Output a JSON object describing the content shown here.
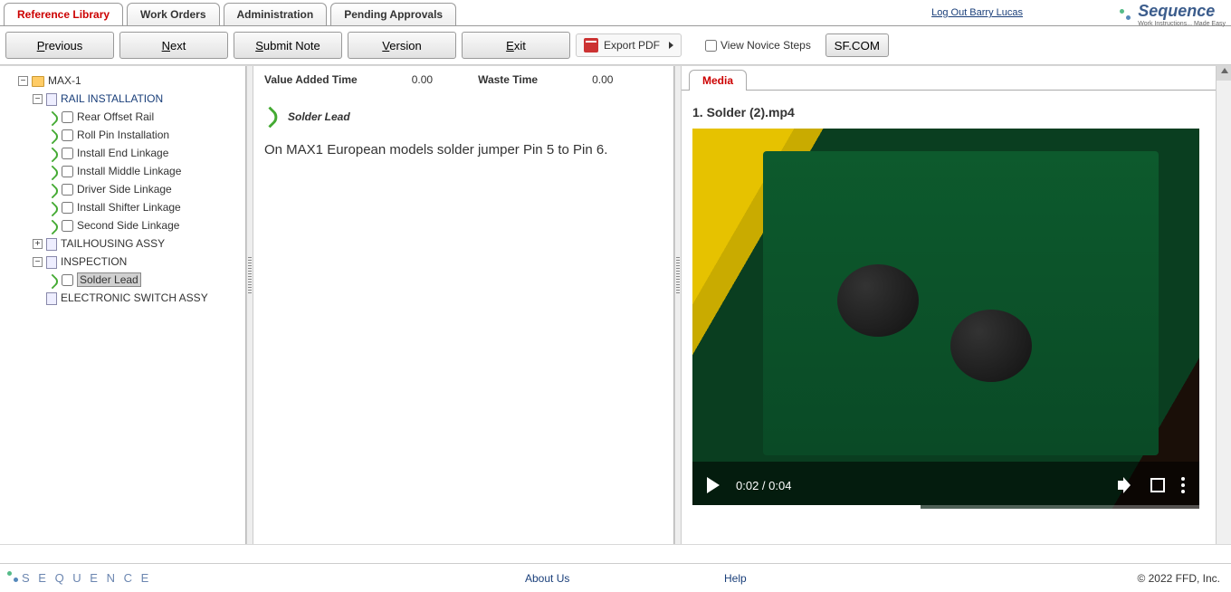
{
  "tabs": [
    "Reference Library",
    "Work Orders",
    "Administration",
    "Pending Approvals"
  ],
  "active_tab": 0,
  "logout": "Log Out Barry Lucas",
  "brand": "Sequence",
  "brand_sub": "Work Instructions... Made Easy",
  "toolbar": {
    "previous": "Previous",
    "next": "Next",
    "submit": "Submit Note",
    "version": "Version",
    "exit": "Exit",
    "export": "Export PDF",
    "novice": "View Novice Steps",
    "sf": "SF.COM"
  },
  "tree": {
    "root": "MAX-1",
    "g1": "RAIL INSTALLATION",
    "g1_items": [
      "Rear Offset Rail",
      "Roll Pin Installation",
      "Install End Linkage",
      "Install Middle Linkage",
      "Driver Side Linkage",
      "Install Shifter Linkage",
      "Second Side Linkage"
    ],
    "g2": "TAILHOUSING ASSY",
    "g3": "INSPECTION",
    "g3_items": [
      "Solder Lead"
    ],
    "g4": "ELECTRONIC SWITCH ASSY"
  },
  "mid": {
    "vat_label": "Value Added Time",
    "vat": "0.00",
    "wt_label": "Waste Time",
    "wt": "0.00",
    "step": "Solder Lead",
    "body": "On MAX1 European models solder jumper Pin 5 to Pin 6."
  },
  "media": {
    "tab": "Media",
    "title": "1. Solder (2).mp4",
    "time": "0:02 / 0:04"
  },
  "footer": {
    "about": "About Us",
    "help": "Help",
    "copy": "© 2022 FFD, Inc."
  }
}
